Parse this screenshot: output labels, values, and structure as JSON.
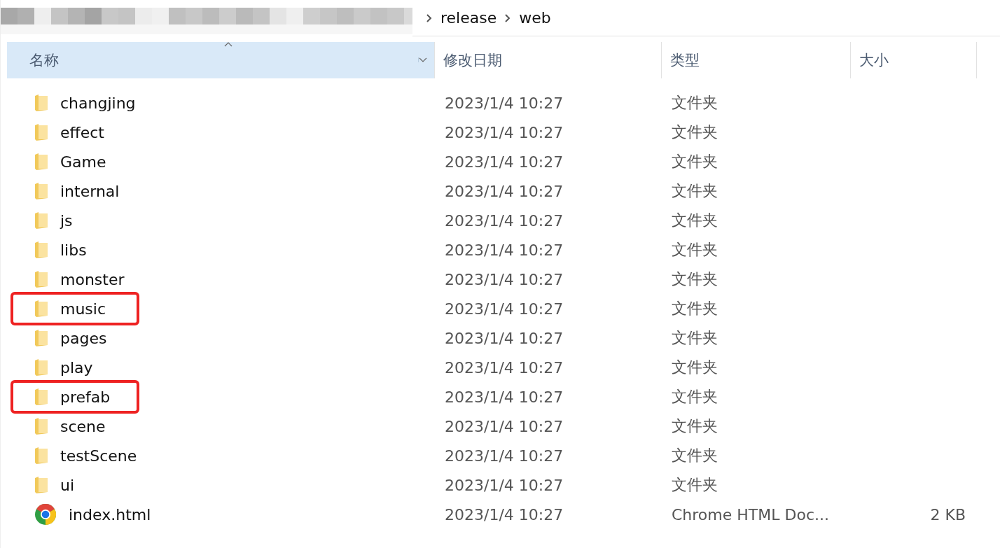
{
  "breadcrumb": [
    "release",
    "web"
  ],
  "columns": [
    {
      "label": "名称",
      "sorted": true
    },
    {
      "label": "修改日期",
      "sorted": false
    },
    {
      "label": "类型",
      "sorted": false
    },
    {
      "label": "大小",
      "sorted": false
    }
  ],
  "rows": [
    {
      "kind": "folder",
      "name": "changjing",
      "modified": "2023/1/4 10:27",
      "type": "文件夹",
      "highlighted": false
    },
    {
      "kind": "folder",
      "name": "effect",
      "modified": "2023/1/4 10:27",
      "type": "文件夹",
      "highlighted": false
    },
    {
      "kind": "folder",
      "name": "Game",
      "modified": "2023/1/4 10:27",
      "type": "文件夹",
      "highlighted": false
    },
    {
      "kind": "folder",
      "name": "internal",
      "modified": "2023/1/4 10:27",
      "type": "文件夹",
      "highlighted": false
    },
    {
      "kind": "folder",
      "name": "js",
      "modified": "2023/1/4 10:27",
      "type": "文件夹",
      "highlighted": false
    },
    {
      "kind": "folder",
      "name": "libs",
      "modified": "2023/1/4 10:27",
      "type": "文件夹",
      "highlighted": false
    },
    {
      "kind": "folder",
      "name": "monster",
      "modified": "2023/1/4 10:27",
      "type": "文件夹",
      "highlighted": false
    },
    {
      "kind": "folder",
      "name": "music",
      "modified": "2023/1/4 10:27",
      "type": "文件夹",
      "highlighted": true
    },
    {
      "kind": "folder",
      "name": "pages",
      "modified": "2023/1/4 10:27",
      "type": "文件夹",
      "highlighted": false
    },
    {
      "kind": "folder",
      "name": "play",
      "modified": "2023/1/4 10:27",
      "type": "文件夹",
      "highlighted": false
    },
    {
      "kind": "folder",
      "name": "prefab",
      "modified": "2023/1/4 10:27",
      "type": "文件夹",
      "highlighted": true
    },
    {
      "kind": "folder",
      "name": "scene",
      "modified": "2023/1/4 10:27",
      "type": "文件夹",
      "highlighted": false
    },
    {
      "kind": "folder",
      "name": "testScene",
      "modified": "2023/1/4 10:27",
      "type": "文件夹",
      "highlighted": false
    },
    {
      "kind": "folder",
      "name": "ui",
      "modified": "2023/1/4 10:27",
      "type": "文件夹",
      "highlighted": false
    },
    {
      "kind": "browser-file",
      "name": "index.html",
      "modified": "2023/1/4 10:27",
      "type": "Chrome HTML Doc...",
      "size": "2 KB",
      "highlighted": false
    }
  ]
}
